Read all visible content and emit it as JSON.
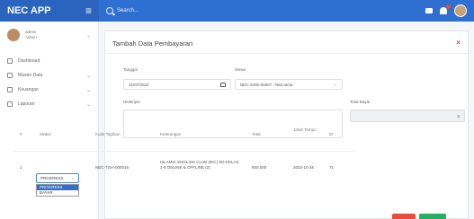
{
  "topbar": {
    "brand": "NEC APP",
    "search_placeholder": "Search..."
  },
  "sidebar": {
    "user_name": "admin",
    "user_role": "Admin",
    "items": [
      {
        "label": "Dashboard",
        "icon": "home-icon"
      },
      {
        "label": "Master Data",
        "icon": "database-icon",
        "has_caret": true
      },
      {
        "label": "Keuangan",
        "icon": "wallet-icon",
        "has_caret": true
      },
      {
        "label": "Laporan",
        "icon": "report-icon",
        "has_caret": true
      }
    ]
  },
  "form": {
    "title": "Tambah Data Pembayaran",
    "tanggal_label": "Tanggal",
    "tanggal_value": "31/07/2022",
    "siswa_label": "Siswa",
    "siswa_value": "NEC-SSW-00007 - Nita tama",
    "deskripsi_label": "Deskripsi",
    "total_bayar_label": "Total Bayar",
    "total_bayar_value": "0"
  },
  "table": {
    "headers": {
      "no": "#",
      "status": "Status",
      "kode": "Kode Tagihan",
      "keterangan": "Keterangan",
      "total": "Total",
      "jatuh": "Jatuh Tempo",
      "id": "ID"
    },
    "row": {
      "no": "1",
      "status": "PROGRESS",
      "kode": "NEC-TGH-000016",
      "keterangan": "ISLAMIC ENGLISH CLUB (IEC) SD-KELAS 1-6 ONLINE & OFFLINE (2)",
      "total": "600.000",
      "jatuh": "2022-10-26",
      "id": "71"
    },
    "status_options": [
      "PROGRESS",
      "BAYAR"
    ]
  }
}
